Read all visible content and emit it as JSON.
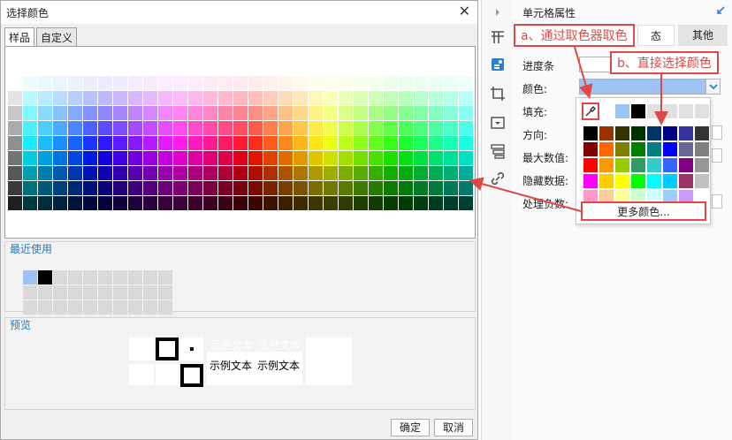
{
  "dialog": {
    "title": "选择颜色",
    "close_glyph": "✕",
    "tabs": [
      {
        "label": "样品",
        "active": true
      },
      {
        "label": "自定义",
        "active": false
      }
    ],
    "recent_title": "最近使用",
    "preview_title": "预览",
    "preview_text": "示例文本",
    "ok_label": "确定",
    "cancel_label": "取消",
    "swatch_grid": {
      "columns": 31,
      "rows": 9
    },
    "recent_colors": [
      "#9dc3f4",
      "#000000"
    ]
  },
  "panel": {
    "title": "单元格属性",
    "collapse_icon": "arrow-icon",
    "tabs": [
      "态",
      "其他"
    ],
    "fields": [
      {
        "label": "进度条"
      },
      {
        "label": "颜色:"
      },
      {
        "label": "填充:"
      },
      {
        "label": "方向:"
      },
      {
        "label": "最大数值:"
      },
      {
        "label": "隐藏数据:"
      },
      {
        "label": "处理负数:"
      }
    ],
    "color_value": "#9dc3f4",
    "more_colors_label": "更多颜色...",
    "popup_top_colors": [
      "#9dc3f4",
      "#000000"
    ],
    "popup_colors": [
      "#000000",
      "#993300",
      "#333300",
      "#003300",
      "#003366",
      "#000080",
      "#333399",
      "#333333",
      "#800000",
      "#ff6600",
      "#808000",
      "#008000",
      "#008080",
      "#0000ff",
      "#666699",
      "#808080",
      "#ff0000",
      "#ff9900",
      "#99cc00",
      "#339966",
      "#33cccc",
      "#3366ff",
      "#800080",
      "#969696",
      "#ff00ff",
      "#ffcc00",
      "#ffff00",
      "#00ff00",
      "#00ffff",
      "#00ccff",
      "#993366",
      "#c0c0c0",
      "#ff99cc",
      "#ffcc99",
      "#ffff99",
      "#ccffcc",
      "#ccffff",
      "#99ccff",
      "#cc99ff",
      "#ffffff"
    ]
  },
  "annotations": {
    "a": "a、通过取色器取色",
    "b": "b、直接选择颜色"
  },
  "colors": {
    "accent": "#2a7ab0",
    "callout": "#e04848"
  }
}
